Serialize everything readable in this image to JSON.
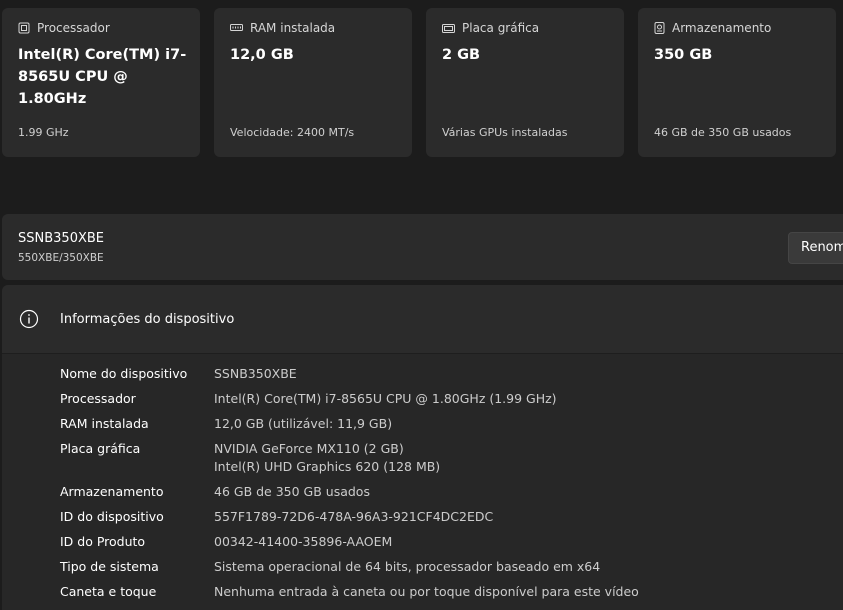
{
  "cards": [
    {
      "icon": "processor-icon",
      "title": "Processador",
      "value": "Intel(R) Core(TM) i7-8565U CPU @ 1.80GHz",
      "sub": "1.99 GHz"
    },
    {
      "icon": "ram-icon",
      "title": "RAM instalada",
      "value": "12,0 GB",
      "sub": "Velocidade: 2400 MT/s"
    },
    {
      "icon": "graphics-card-icon",
      "title": "Placa gráfica",
      "value": "2 GB",
      "sub": "Várias GPUs instaladas"
    },
    {
      "icon": "storage-icon",
      "title": "Armazenamento",
      "value": "350 GB",
      "sub": "46 GB de 350 GB usados"
    }
  ],
  "device": {
    "name": "SSNB350XBE",
    "model": "550XBE/350XBE",
    "rename_label": "Renomear"
  },
  "info": {
    "icon": "info-icon",
    "title": "Informações do dispositivo",
    "specs": [
      {
        "label": "Nome do dispositivo",
        "value": "SSNB350XBE"
      },
      {
        "label": "Processador",
        "value": "Intel(R) Core(TM) i7-8565U CPU @ 1.80GHz (1.99 GHz)"
      },
      {
        "label": "RAM instalada",
        "value": "12,0 GB (utilizável: 11,9 GB)"
      },
      {
        "label": "Placa gráfica",
        "value": "NVIDIA GeForce MX110 (2 GB)",
        "value2": "Intel(R) UHD Graphics 620 (128 MB)"
      },
      {
        "label": "Armazenamento",
        "value": "46 GB de 350 GB usados"
      },
      {
        "label": "ID do dispositivo",
        "value": "557F1789-72D6-478A-96A3-921CF4DC2EDC"
      },
      {
        "label": "ID do Produto",
        "value": "00342-41400-35896-AAOEM"
      },
      {
        "label": "Tipo de sistema",
        "value": "Sistema operacional de 64 bits, processador baseado em x64"
      },
      {
        "label": "Caneta e toque",
        "value": "Nenhuma entrada à caneta ou por toque disponível para este vídeo"
      }
    ]
  }
}
